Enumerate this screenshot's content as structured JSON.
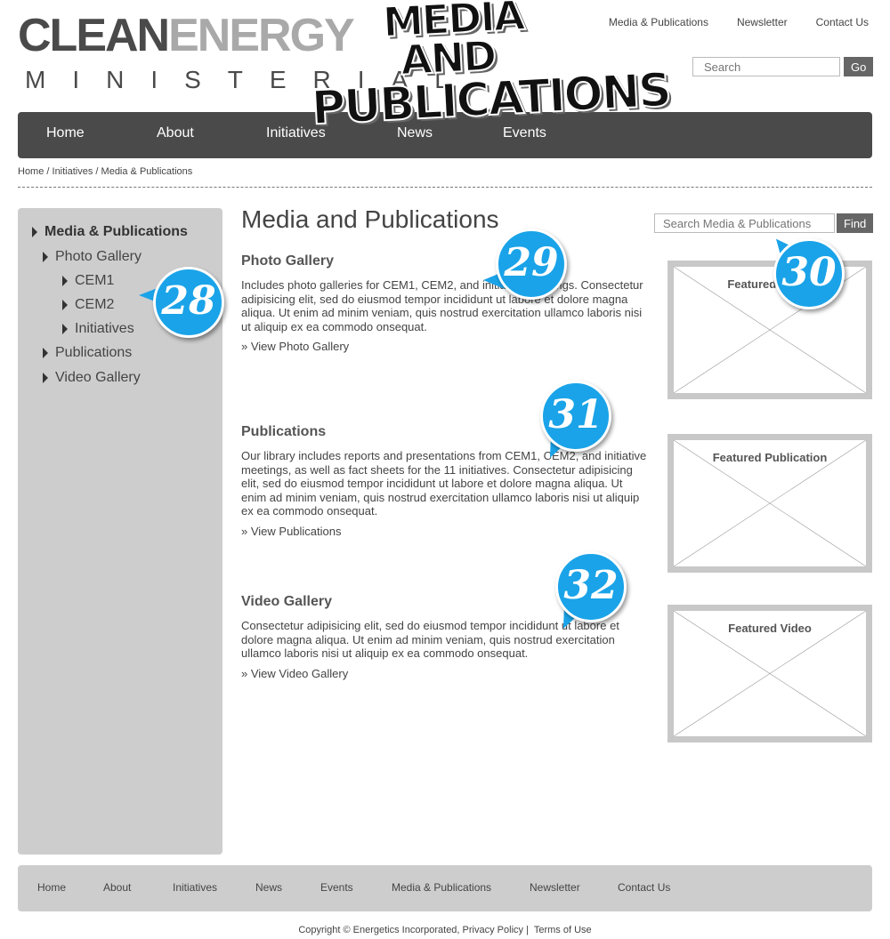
{
  "logo": {
    "word1": "CLEAN",
    "word2": "ENERGY",
    "subtitle": "MINISTERIAL"
  },
  "sticker": {
    "line1": "MEDIA",
    "line2": "AND",
    "line3": "PUBLICATIONS"
  },
  "utility_nav": [
    "Media & Publications",
    "Newsletter",
    "Contact Us"
  ],
  "site_search": {
    "placeholder": "Search",
    "button": "Go"
  },
  "main_nav": [
    "Home",
    "About",
    "Initiatives",
    "News",
    "Events"
  ],
  "breadcrumb": "Home / Initiatives / Media & Publications",
  "sidebar": {
    "active": "Media & Publications",
    "items": [
      "Photo Gallery",
      "CEM1",
      "CEM2",
      "Initiatives",
      "Publications",
      "Video Gallery"
    ]
  },
  "page_title": "Media and Publications",
  "content_search": {
    "placeholder": "Search Media & Publications",
    "button": "Find"
  },
  "sections": [
    {
      "title": "Photo Gallery",
      "body": "Includes photo galleries for CEM1, CEM2, and initiative meetings. Consectetur adipisicing elit, sed do eiusmod tempor incididunt ut labore et dolore magna aliqua. Ut enim ad minim veniam, quis nostrud exercitation ullamco laboris nisi ut aliquip ex ea commodo onsequat.",
      "link": "» View Photo Gallery",
      "featured": "Featured Photo"
    },
    {
      "title": "Publications",
      "body": "Our library includes reports and presentations from CEM1, CEM2, and initiative meetings, as well as fact sheets for the 11 initiatives. Consectetur adipisicing elit, sed do eiusmod tempor incididunt ut labore et dolore magna aliqua. Ut enim ad minim veniam, quis nostrud exercitation ullamco laboris nisi ut aliquip ex ea commodo onsequat.",
      "link": "» View Publications",
      "featured": "Featured Publication"
    },
    {
      "title": "Video Gallery",
      "body": "Consectetur adipisicing elit, sed do eiusmod tempor incididunt ut labore et dolore magna aliqua. Ut enim ad minim veniam, quis nostrud exercitation ullamco laboris nisi ut aliquip ex ea commodo onsequat.",
      "link": "» View Video Gallery",
      "featured": "Featured Video"
    }
  ],
  "badges": [
    "28",
    "29",
    "30",
    "31",
    "32"
  ],
  "badge_color": "#1aa3e8",
  "footer_nav": [
    "Home",
    "About",
    "Initiatives",
    "News",
    "Events",
    "Media & Publications",
    "Newsletter",
    "Contact Us"
  ],
  "copyright": {
    "text": "Copyright © Energetics Incorporated,",
    "privacy": "Privacy Policy",
    "separator": "|",
    "terms": "Terms of Use"
  }
}
